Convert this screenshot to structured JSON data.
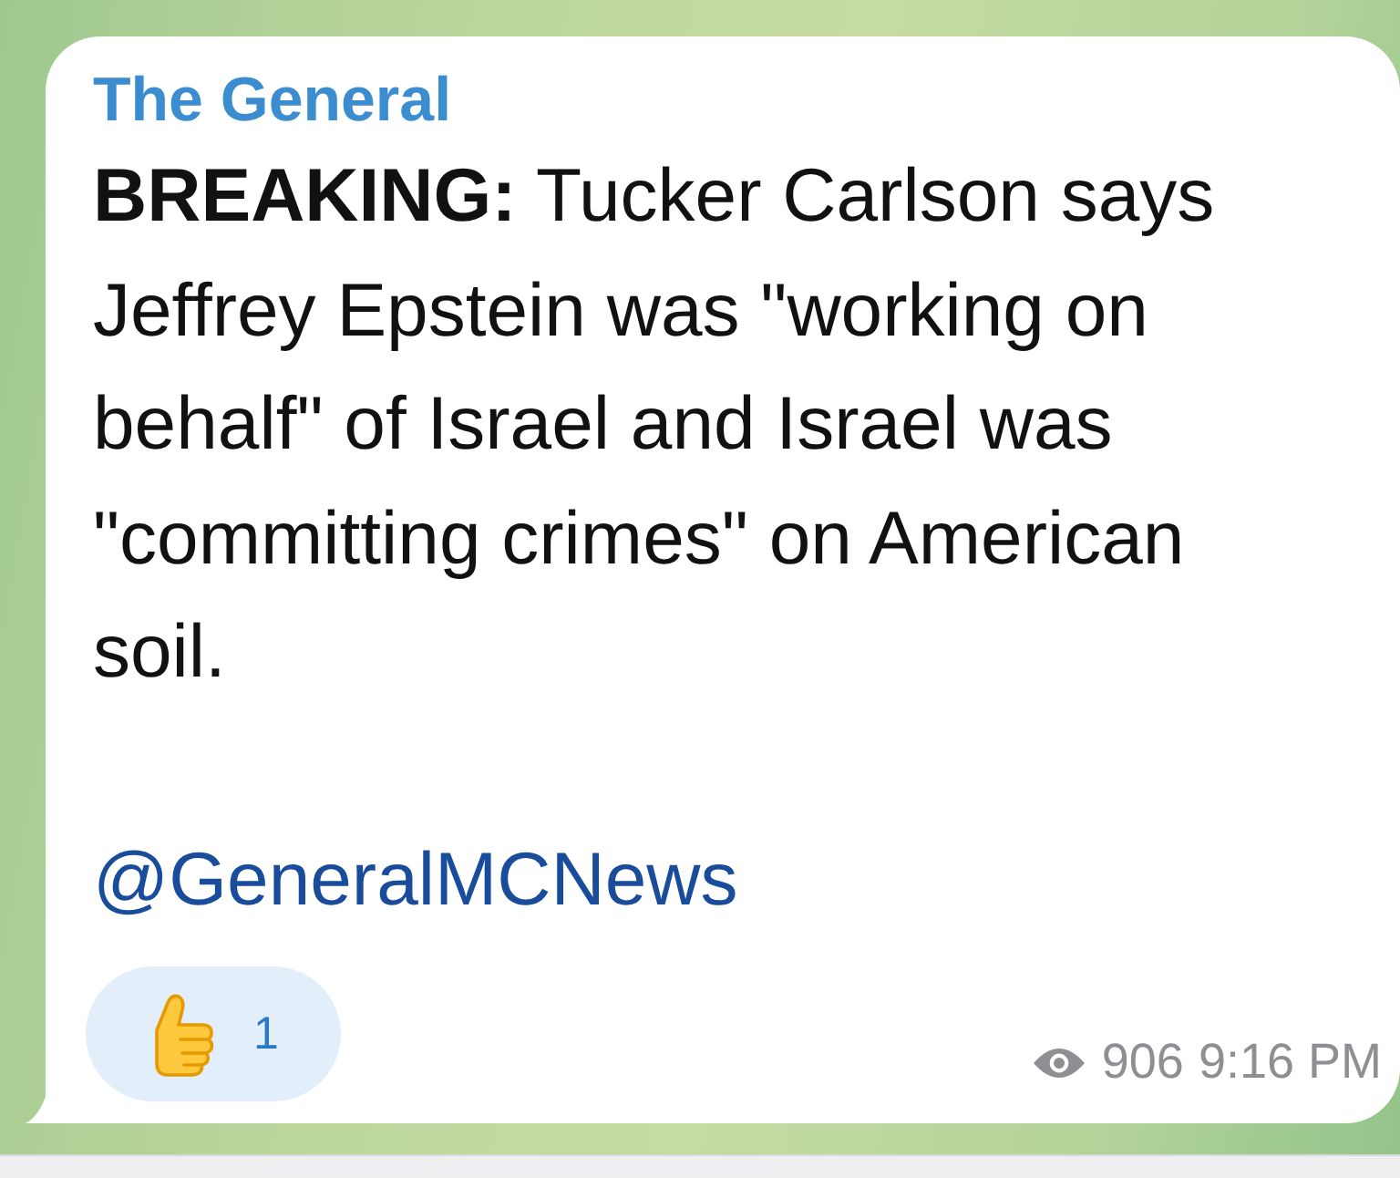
{
  "channel_post": {
    "sender": "The General",
    "body": "**BREAKING:** Tucker Carlson says Jeffrey Epstein was \"working on behalf\" of Israel and Israel was \"committing crimes\" on American soil.",
    "link": "@GeneralMCNews",
    "reactions": [
      {
        "kind": "thumbs_up",
        "count": "1",
        "selected": false
      }
    ],
    "views": "906",
    "time": "9:16 PM"
  }
}
